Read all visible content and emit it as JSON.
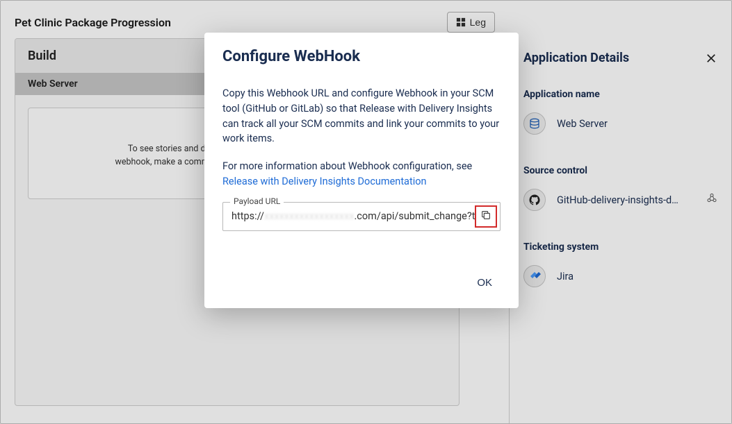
{
  "page": {
    "title": "Pet Clinic Package Progression",
    "legend_button": "Leg"
  },
  "build": {
    "title": "Build",
    "subtitle": "Web Server",
    "empty_text": "To see stories and defects here, configure source control webhook, make a commit and use the Track code changes task to update board."
  },
  "details": {
    "title": "Application Details",
    "app_name_label": "Application name",
    "app_name_value": "Web Server",
    "source_control_label": "Source control",
    "source_control_value": "GitHub-delivery-insights-d…",
    "ticketing_label": "Ticketing system",
    "ticketing_value": "Jira"
  },
  "modal": {
    "title": "Configure WebHook",
    "para1": "Copy this Webhook URL and configure Webhook in your SCM tool (GitHub or GitLab) so that Release with Delivery Insights can track all your SCM commits and link your commits to your work items.",
    "para2_prefix": "For more information about Webhook configuration, see ",
    "link_text": "Release with Delivery Insights Documentation",
    "payload_label": "Payload URL",
    "payload_prefix": "https://",
    "payload_blurred": "xxxxxxxxxxxxxxxxxx",
    "payload_suffix": ".com/api/submit_change?t",
    "ok_label": "OK"
  }
}
